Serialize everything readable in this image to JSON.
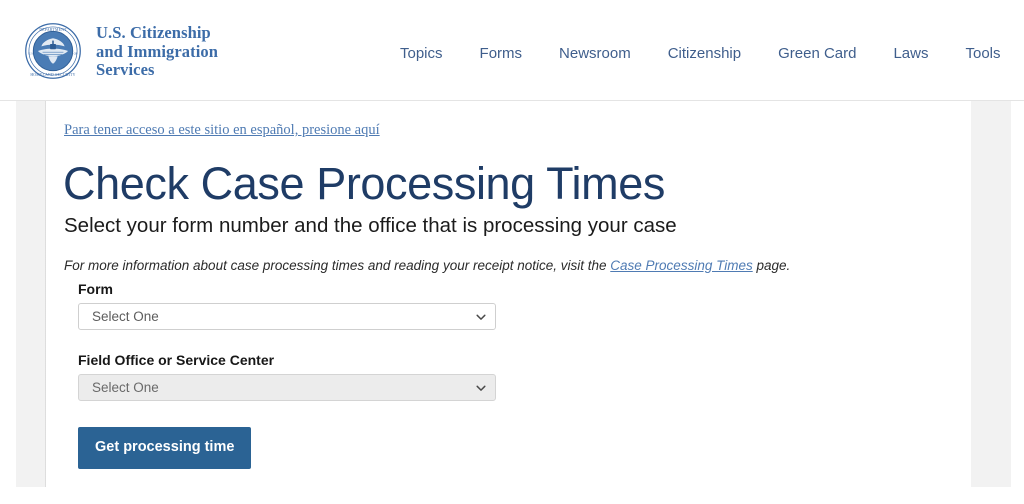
{
  "header": {
    "logo": {
      "seal_icon": "dhs-seal-icon",
      "line1": "U.S. Citizenship",
      "line2": "and Immigration",
      "line3": "Services"
    },
    "nav": [
      {
        "label": "Topics"
      },
      {
        "label": "Forms"
      },
      {
        "label": "Newsroom"
      },
      {
        "label": "Citizenship"
      },
      {
        "label": "Green Card"
      },
      {
        "label": "Laws"
      },
      {
        "label": "Tools"
      }
    ]
  },
  "content": {
    "spanish_link": "Para tener acceso a este sitio en español, presione aquí",
    "title": "Check Case Processing Times",
    "subtitle": "Select your form number and the office that is processing your case",
    "note_prefix": "For more information about case processing times and reading your receipt notice, visit the ",
    "note_link": "Case Processing Times",
    "note_suffix": " page."
  },
  "form": {
    "form_field": {
      "label": "Form",
      "value": "Select One",
      "placeholder": "Select One",
      "disabled": false,
      "chevron_icon": "chevron-down-icon"
    },
    "office_field": {
      "label": "Field Office or Service Center",
      "value": "Select One",
      "placeholder": "Select One",
      "disabled": true,
      "chevron_icon": "chevron-down-icon"
    },
    "submit_label": "Get processing time"
  },
  "colors": {
    "brand_blue": "#3c6ca8",
    "nav_blue": "#3f5e8c",
    "title_navy": "#1f3c66",
    "link_blue": "#4f7bb3",
    "button_blue": "#2b6394",
    "gutter_grey": "#f2f2f2",
    "disabled_grey": "#ececec"
  }
}
